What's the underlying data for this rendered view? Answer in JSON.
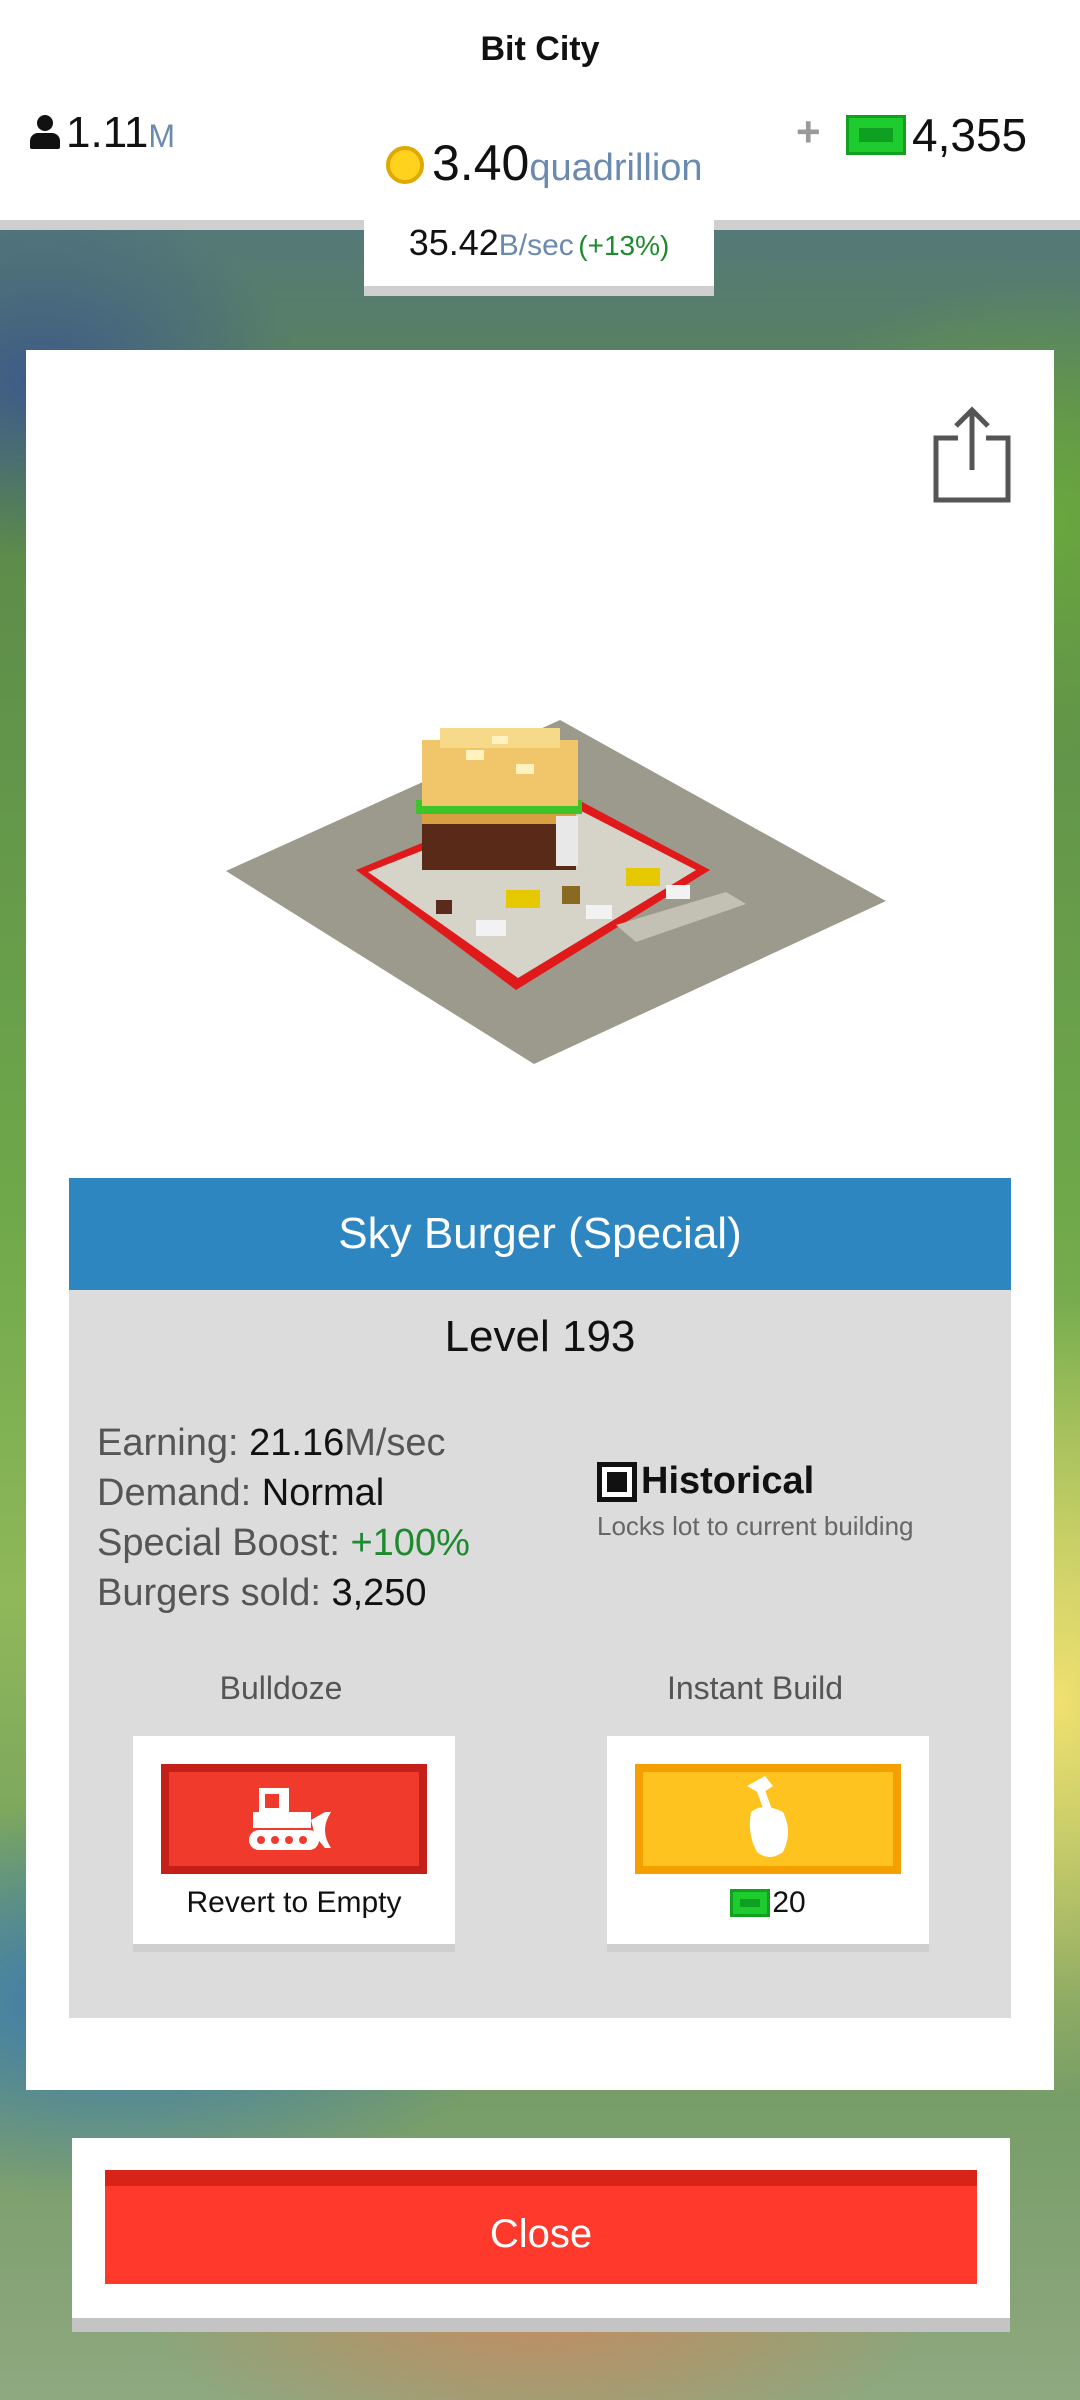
{
  "app": {
    "title": "Bit City"
  },
  "hud": {
    "population": {
      "value": "1.11",
      "unit": "M"
    },
    "coins": {
      "value": "3.40",
      "unit": "quadrillion"
    },
    "plus_label": "+",
    "cash": {
      "value": "4,355"
    },
    "rate": {
      "value": "35.42",
      "unit": "B/sec",
      "change": "(+13%)"
    }
  },
  "building": {
    "name": "Sky Burger (Special)",
    "level": "Level 193",
    "stats": {
      "earning_label": "Earning:",
      "earning_value": "21.16",
      "earning_unit": "M/sec",
      "demand_label": "Demand:",
      "demand_value": "Normal",
      "boost_label": "Special Boost:",
      "boost_value": "+100%",
      "sold_label": "Burgers sold:",
      "sold_value": "3,250"
    },
    "historical": {
      "label": "Historical",
      "description": "Locks lot to current building",
      "checked": true
    }
  },
  "actions": {
    "bulldoze": {
      "title": "Bulldoze",
      "caption": "Revert to Empty",
      "icon": "bulldozer-icon"
    },
    "instant_build": {
      "title": "Instant Build",
      "cost": "20",
      "icon": "hammer-icon"
    }
  },
  "close": {
    "label": "Close"
  },
  "colors": {
    "header_blue": "#2e86c1",
    "close_red": "#ff3a2c",
    "bulldoze_red": "#f03a2c",
    "instant_yellow": "#ffc31f",
    "cash_green": "#1fcc2f",
    "positive_green": "#1d8a2e"
  }
}
